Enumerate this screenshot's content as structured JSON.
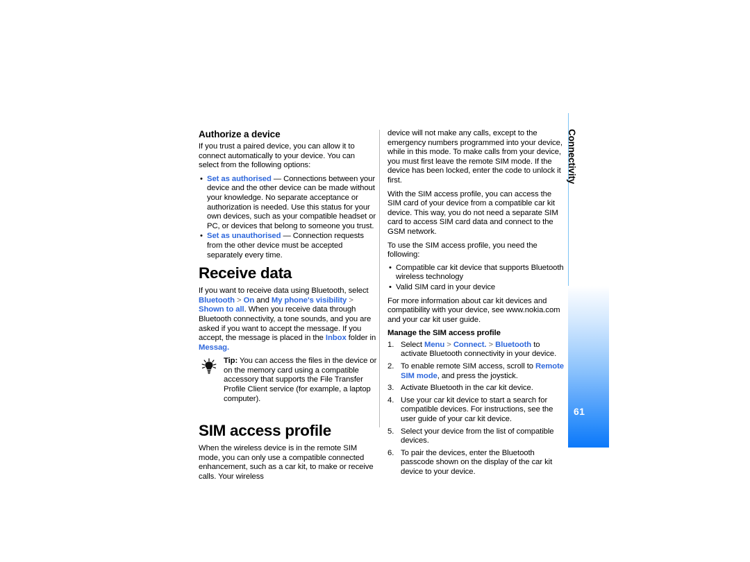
{
  "document": {
    "page_number": "61",
    "chapter_label": "Connectivity",
    "accent_color": "#2f68dc",
    "sidebar_gradient_end": "#0d79fa",
    "sidebar_rule_color": "#7dc4f5"
  },
  "left_column": {
    "heading_authorize": "Authorize a device",
    "intro": "If you trust a paired device, you can allow it to connect automatically to your device. You can select from the following options:",
    "options": [
      {
        "bullet": "•",
        "link": "Set as authorised",
        "dash": " — ",
        "text": "Connections between your device and the other device can be made without your knowledge. No separate acceptance or authorization is needed. Use this status for your own devices, such as your compatible headset or PC, or devices that belong to someone you trust."
      },
      {
        "bullet": "•",
        "link": "Set as unauthorised",
        "dash": " — ",
        "text": "Connection requests from the other device must be accepted separately every time."
      }
    ],
    "heading_receive": "Receive data",
    "receive": {
      "part1": "If you want to receive data using Bluetooth, select ",
      "link_bluetooth": "Bluetooth",
      "sep1": " > ",
      "link_on": "On",
      "and": " and ",
      "link_visibility": "My phone's visibility",
      "sep2": " > ",
      "link_shown": "Shown to all",
      "part2": ". When you receive data through Bluetooth connectivity, a tone sounds, and you are asked if you want to accept the message. If you accept, the message is placed in the ",
      "link_inbox": "Inbox",
      "part3": " folder in ",
      "link_messag": "Messag.",
      "part4": ""
    },
    "tip": {
      "icon": "lightbulb-icon",
      "label": "Tip:",
      "text": " You can access the files in the device or on the memory card using a compatible accessory that supports the File Transfer Profile Client service (for example, a laptop computer)."
    },
    "heading_sim": "SIM access profile",
    "sim_intro": "When the wireless device is in the remote SIM mode, you can only use a compatible connected enhancement, such as a car kit, to make or receive calls. Your wireless"
  },
  "right_column": {
    "continuation": "device will not make any calls, except to the emergency numbers programmed into your device, while in this mode. To make calls from your device, you must first leave the remote SIM mode. If the device has been locked, enter the code to unlock it first.",
    "para_profile": "With the SIM access profile, you can access the SIM card of your device from a compatible car kit device. This way, you do not need a separate SIM card to access SIM card data and connect to the GSM network.",
    "para_requirements": "To use the SIM access profile, you need the following:",
    "requirements": [
      {
        "bullet": "•",
        "text": "Compatible car kit device that supports Bluetooth wireless technology"
      },
      {
        "bullet": "•",
        "text": "Valid SIM card in your device"
      }
    ],
    "para_more_info": "For more information about car kit devices and compatibility with your device, see www.nokia.com and your car kit user guide.",
    "heading_manage": "Manage the SIM access profile",
    "steps": [
      {
        "num": "1.",
        "pre": "Select ",
        "link1": "Menu",
        "sep1": " > ",
        "link2": "Connect.",
        "sep2": " > ",
        "link3": "Bluetooth",
        "post": " to activate Bluetooth connectivity in your device."
      },
      {
        "num": "2.",
        "pre": "To enable remote SIM access, scroll to ",
        "link1": "Remote SIM mode",
        "post": ", and press the joystick."
      },
      {
        "num": "3.",
        "pre": "Activate Bluetooth in the car kit device.",
        "post": ""
      },
      {
        "num": "4.",
        "pre": "Use your car kit device to start a search for compatible devices. For instructions, see the user guide of your car kit device.",
        "post": ""
      },
      {
        "num": "5.",
        "pre": "Select your device from the list of compatible devices.",
        "post": ""
      },
      {
        "num": "6.",
        "pre": "To pair the devices, enter the Bluetooth passcode shown on the display of the car kit device to your device.",
        "post": ""
      }
    ]
  }
}
